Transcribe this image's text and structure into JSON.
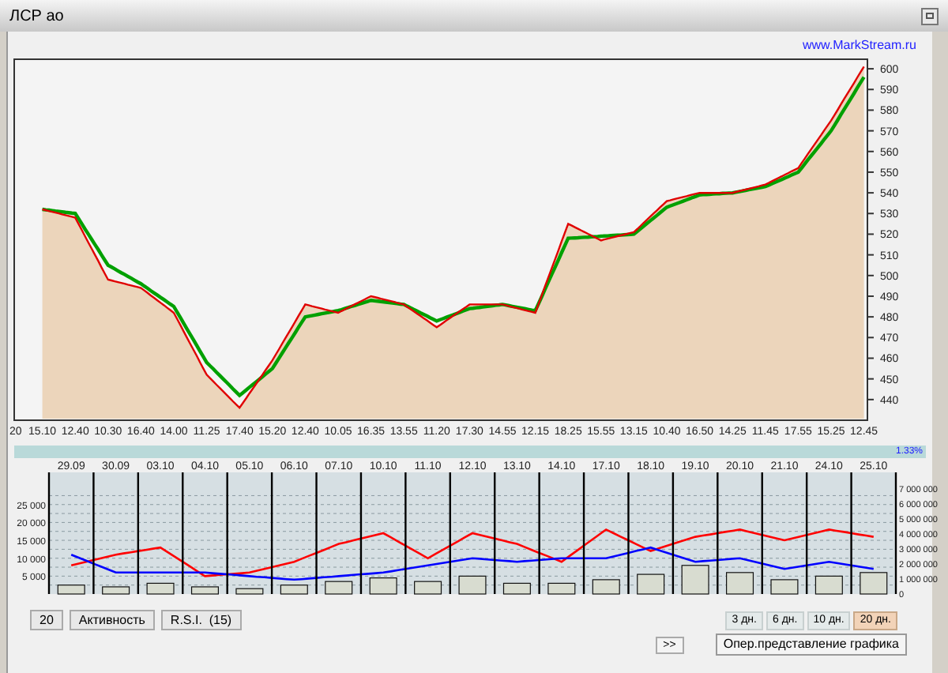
{
  "window": {
    "title": "ЛСР ао"
  },
  "link": "www.MarkStream.ru",
  "price_chart": {
    "chart_data": {
      "type": "area",
      "categories": [
        "20",
        "15.10",
        "12.40",
        "10.30",
        "16.40",
        "14.00",
        "11.25",
        "17.40",
        "15.20",
        "12.40",
        "10.05",
        "16.35",
        "13.55",
        "11.20",
        "17.30",
        "14.55",
        "12.15",
        "18.25",
        "15.55",
        "13.15",
        "10.40",
        "16.50",
        "14.25",
        "11.45",
        "17.55",
        "15.25",
        "12.45"
      ],
      "series": [
        {
          "color": "#e00000",
          "values": [
            null,
            532,
            528,
            498,
            494,
            482,
            452,
            436,
            459,
            486,
            482,
            490,
            486,
            475,
            486,
            486,
            482,
            525,
            517,
            521,
            536,
            540,
            540,
            544,
            552,
            575,
            601
          ]
        },
        {
          "type": "line",
          "color": "#00a000",
          "values": [
            null,
            532,
            530,
            505,
            496,
            485,
            458,
            442,
            455,
            480,
            483,
            488,
            486,
            478,
            484,
            486,
            483,
            518,
            519,
            520,
            533,
            539,
            540,
            543,
            550,
            570,
            596
          ]
        }
      ],
      "ylim": [
        430,
        605
      ],
      "yticks": [
        440,
        450,
        460,
        470,
        480,
        490,
        500,
        510,
        520,
        530,
        540,
        550,
        560,
        570,
        580,
        590,
        600
      ]
    }
  },
  "indicator_strip": {
    "reading": "1.33%"
  },
  "activity_chart": {
    "chart_data": {
      "type": "line",
      "grid": true,
      "categories": [
        "29.09",
        "30.09",
        "03.10",
        "04.10",
        "05.10",
        "06.10",
        "07.10",
        "10.10",
        "11.10",
        "12.10",
        "13.10",
        "14.10",
        "17.10",
        "18.10",
        "19.10",
        "20.10",
        "21.10",
        "24.10",
        "25.10"
      ],
      "series": [
        {
          "color": "#ff0000",
          "values": [
            8000,
            11000,
            13000,
            5000,
            6000,
            9000,
            14000,
            17000,
            10000,
            17000,
            14000,
            9000,
            18000,
            12000,
            16000,
            18000,
            15000,
            18000,
            16000
          ]
        },
        {
          "color": "#0000ff",
          "values": [
            11000,
            6000,
            6000,
            6000,
            5000,
            4000,
            5000,
            6000,
            8000,
            10000,
            9000,
            10000,
            10000,
            13000,
            9000,
            10000,
            7000,
            9000,
            7000
          ]
        },
        {
          "type": "bar",
          "color": "#d8dcd0",
          "values": [
            2500,
            2000,
            3000,
            2000,
            1500,
            2500,
            3500,
            4500,
            3500,
            5000,
            3000,
            3000,
            4000,
            5500,
            8000,
            6000,
            4000,
            5000,
            6000
          ]
        }
      ],
      "ylim": [
        0,
        34000
      ],
      "yticks": [
        {
          "value": 5000,
          "label": "5 000"
        },
        {
          "value": 10000,
          "label": "10 000"
        },
        {
          "value": 15000,
          "label": "15 000"
        },
        {
          "value": 20000,
          "label": "20 000"
        },
        {
          "value": 25000,
          "label": "25 000"
        }
      ]
    },
    "right_axis_ticks": [
      "7 000 000",
      "6 000 000",
      "5 000 000",
      "4 000 000",
      "3 000 000",
      "2 000 000",
      "1 000 000",
      "0"
    ]
  },
  "buttons": [
    {
      "label": "20"
    },
    {
      "label": "Активность"
    },
    {
      "label": "R.S.I.  (15)"
    }
  ],
  "periods": [
    {
      "label": "3 дн.",
      "selected": false
    },
    {
      "label": "6 дн.",
      "selected": false
    },
    {
      "label": "10 дн.",
      "selected": false
    },
    {
      "label": "20 дн.",
      "selected": true
    }
  ],
  "scroll_button": ">>",
  "view_button": "Опер.представление графика"
}
